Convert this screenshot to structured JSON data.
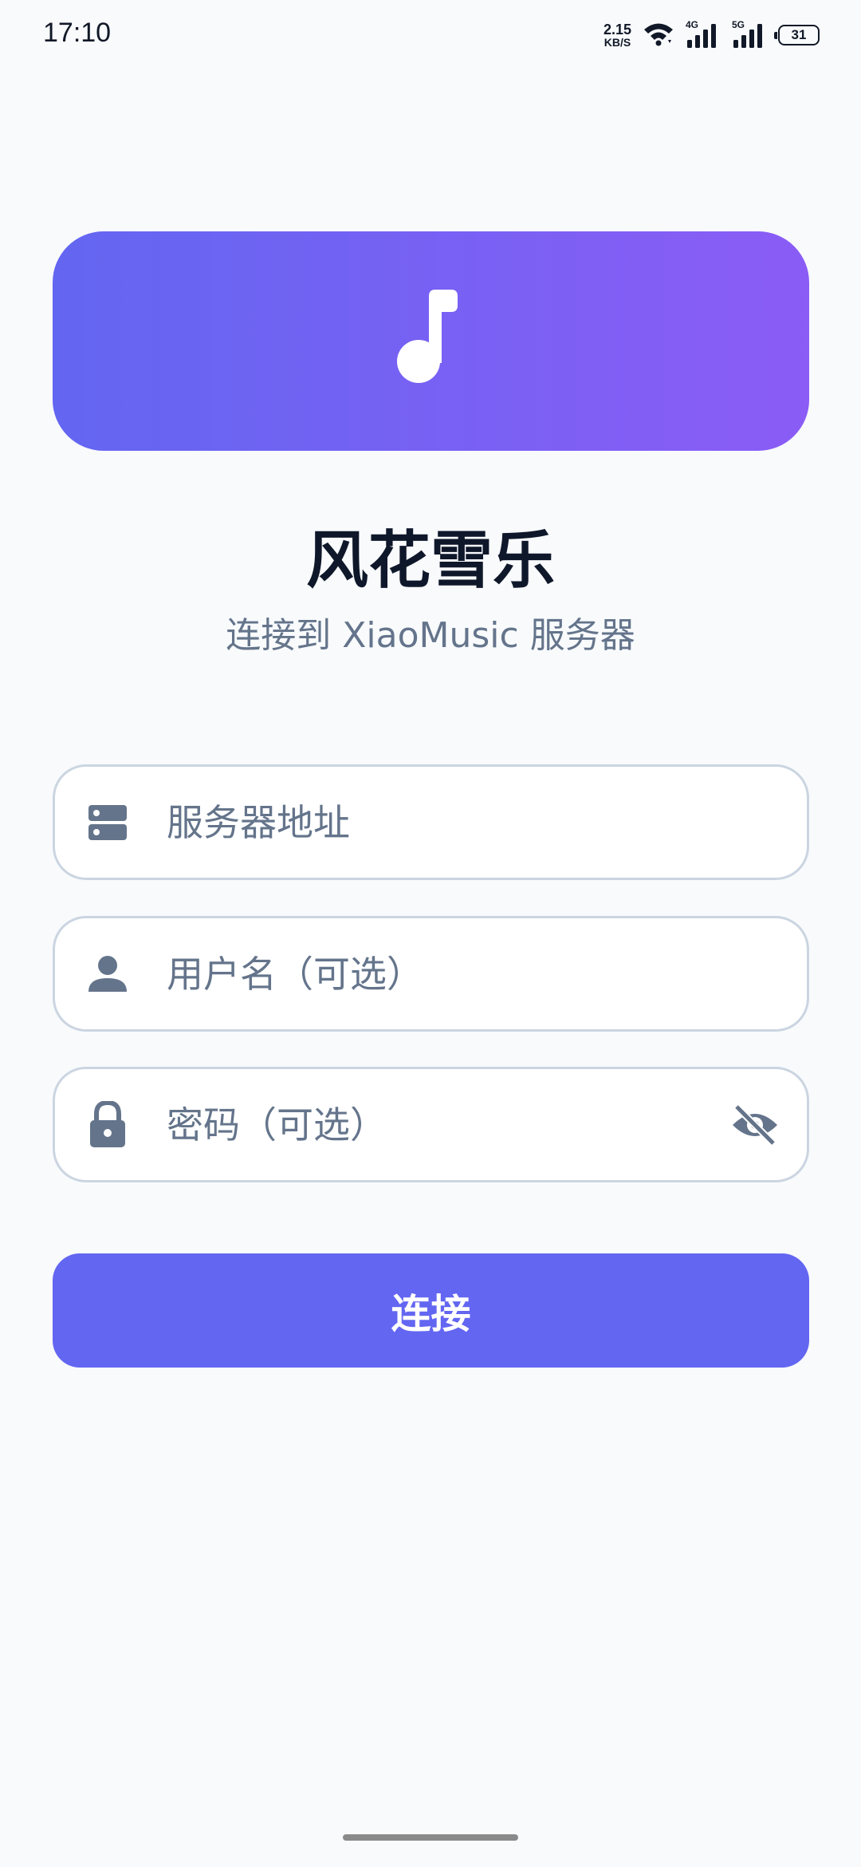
{
  "status_bar": {
    "time": "17:10",
    "net_speed_value": "2.15",
    "net_speed_unit": "KB/S",
    "signal_1_tag": "4G",
    "signal_2_tag": "5G",
    "battery_level": "31",
    "icons": [
      "wifi-icon",
      "signal-4g-icon",
      "signal-5g-icon",
      "battery-icon"
    ]
  },
  "banner": {
    "icon": "music-note-icon",
    "gradient_start": "#6366f1",
    "gradient_end": "#8b5cf6"
  },
  "app": {
    "title": "风花雪乐",
    "subtitle": "连接到 XiaoMusic 服务器"
  },
  "form": {
    "server": {
      "placeholder": "服务器地址",
      "value": "",
      "icon": "server-icon"
    },
    "username": {
      "placeholder": "用户名（可选）",
      "value": "",
      "icon": "person-icon"
    },
    "password": {
      "placeholder": "密码（可选）",
      "value": "",
      "icon": "lock-icon",
      "toggle_icon": "eye-off-icon"
    },
    "connect_label": "连接"
  },
  "colors": {
    "accent": "#6366f1",
    "background": "#f8fafc",
    "icon_gray": "#64748b"
  }
}
